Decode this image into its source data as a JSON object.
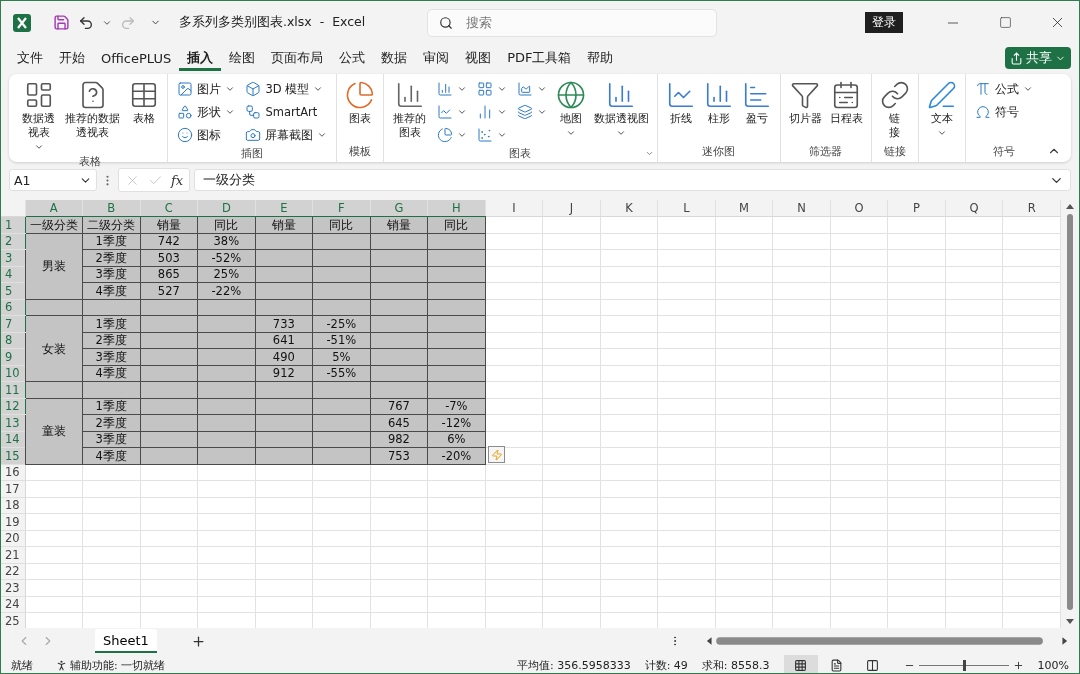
{
  "title_bar": {
    "title": "多系列多类别图表.xlsx  -  Excel",
    "search": {
      "placeholder": "搜索"
    },
    "login": "登录",
    "redo_disabled": true
  },
  "menu": {
    "tabs": [
      {
        "label": "文件",
        "selected": false
      },
      {
        "label": "开始",
        "selected": false
      },
      {
        "label": "OfficePLUS",
        "selected": false
      },
      {
        "label": "插入",
        "selected": true
      },
      {
        "label": "绘图",
        "selected": false
      },
      {
        "label": "页面布局",
        "selected": false
      },
      {
        "label": "公式",
        "selected": false
      },
      {
        "label": "数据",
        "selected": false
      },
      {
        "label": "审阅",
        "selected": false
      },
      {
        "label": "视图",
        "selected": false
      },
      {
        "label": "PDF工具箱",
        "selected": false
      },
      {
        "label": "帮助",
        "selected": false
      }
    ],
    "share": "共享"
  },
  "ribbon": {
    "groups": [
      {
        "label": "表格",
        "items": [
          {
            "kind": "large",
            "label": "数据透视表",
            "dropdown": true
          },
          {
            "kind": "large",
            "label": "推荐的数据透视表"
          },
          {
            "kind": "large",
            "label": "表格"
          }
        ]
      },
      {
        "label": "插图",
        "items": [
          {
            "kind": "small",
            "label": "图片",
            "dropdown": true
          },
          {
            "kind": "small",
            "label": "形状",
            "dropdown": true
          },
          {
            "kind": "small",
            "label": "图标"
          },
          {
            "kind": "small",
            "label": "3D 模型",
            "dropdown": true
          },
          {
            "kind": "small",
            "label": "SmartArt"
          },
          {
            "kind": "small",
            "label": "屏幕截图",
            "dropdown": true
          }
        ]
      },
      {
        "label": "模板",
        "items": [
          {
            "kind": "large",
            "label": "图表"
          }
        ]
      },
      {
        "label": "图表",
        "launcher": true,
        "items": [
          {
            "kind": "large",
            "label": "推荐的图表"
          },
          {
            "kind": "icon",
            "dropdown": true
          },
          {
            "kind": "icon",
            "dropdown": true
          },
          {
            "kind": "icon",
            "dropdown": true
          },
          {
            "kind": "icon",
            "dropdown": true
          },
          {
            "kind": "icon",
            "dropdown": true
          },
          {
            "kind": "icon",
            "dropdown": true
          },
          {
            "kind": "icon",
            "dropdown": true
          },
          {
            "kind": "icon",
            "dropdown": true
          },
          {
            "kind": "large",
            "label": "地图",
            "dropdown": true
          },
          {
            "kind": "large",
            "label": "数据透视图",
            "dropdown": true
          }
        ]
      },
      {
        "label": "迷你图",
        "items": [
          {
            "kind": "large",
            "label": "折线"
          },
          {
            "kind": "large",
            "label": "柱形"
          },
          {
            "kind": "large",
            "label": "盈亏"
          }
        ]
      },
      {
        "label": "筛选器",
        "items": [
          {
            "kind": "large",
            "label": "切片器"
          },
          {
            "kind": "large",
            "label": "日程表"
          }
        ]
      },
      {
        "label": "链接",
        "items": [
          {
            "kind": "large",
            "label": "链接"
          }
        ]
      },
      {
        "items": [
          {
            "kind": "large",
            "label": "文本",
            "dropdown": true
          }
        ]
      },
      {
        "label": "符号",
        "items": [
          {
            "kind": "small",
            "label": "公式",
            "dropdown": true
          },
          {
            "kind": "small",
            "label": "符号"
          }
        ]
      }
    ]
  },
  "formula_bar": {
    "name_box": "A1",
    "function_symbol": "fx",
    "value": "一级分类"
  },
  "sheet": {
    "columns": [
      "A",
      "B",
      "C",
      "D",
      "E",
      "F",
      "G",
      "H",
      "I",
      "J",
      "K",
      "L",
      "M",
      "N",
      "O",
      "P",
      "Q",
      "R"
    ],
    "row_numbers": [
      "1",
      "2",
      "3",
      "4",
      "5",
      "6",
      "7",
      "8",
      "9",
      "10",
      "11",
      "12",
      "13",
      "14",
      "15",
      "16",
      "17",
      "18",
      "19",
      "20",
      "21",
      "22",
      "23",
      "24",
      "25"
    ],
    "header": [
      "一级分类",
      "二级分类",
      "销量",
      "同比",
      "销量",
      "同比",
      "销量",
      "同比"
    ],
    "groups": [
      {
        "label": "男装",
        "rows": [
          {
            "label": "1季度",
            "sales": "742",
            "yoy": "38%"
          },
          {
            "label": "2季度",
            "sales": "503",
            "yoy": "-52%"
          },
          {
            "label": "3季度",
            "sales": "865",
            "yoy": "25%"
          },
          {
            "label": "4季度",
            "sales": "527",
            "yoy": "-22%"
          }
        ]
      },
      {
        "label": "女装",
        "rows": [
          {
            "label": "1季度",
            "sales": "733",
            "yoy": "-25%"
          },
          {
            "label": "2季度",
            "sales": "641",
            "yoy": "-51%"
          },
          {
            "label": "3季度",
            "sales": "490",
            "yoy": "5%"
          },
          {
            "label": "4季度",
            "sales": "912",
            "yoy": "-55%"
          }
        ]
      },
      {
        "label": "童装",
        "rows": [
          {
            "label": "1季度",
            "sales": "767",
            "yoy": "-7%"
          },
          {
            "label": "2季度",
            "sales": "645",
            "yoy": "-12%"
          },
          {
            "label": "3季度",
            "sales": "982",
            "yoy": "6%"
          },
          {
            "label": "4季度",
            "sales": "753",
            "yoy": "-20%"
          }
        ]
      }
    ]
  },
  "sheet_tabs": [
    {
      "label": "Sheet1",
      "selected": true
    }
  ],
  "status_bar": {
    "ready": "就绪",
    "accessibility": "辅助功能: 一切就绪",
    "average": "平均值: 356.5958333",
    "count": "计数: 49",
    "sum": "求和: 8558.3",
    "views": [
      {
        "selected": true
      },
      {
        "selected": false
      },
      {
        "selected": false
      }
    ],
    "zoom": {
      "level": 0.5,
      "reading": "100%"
    }
  }
}
